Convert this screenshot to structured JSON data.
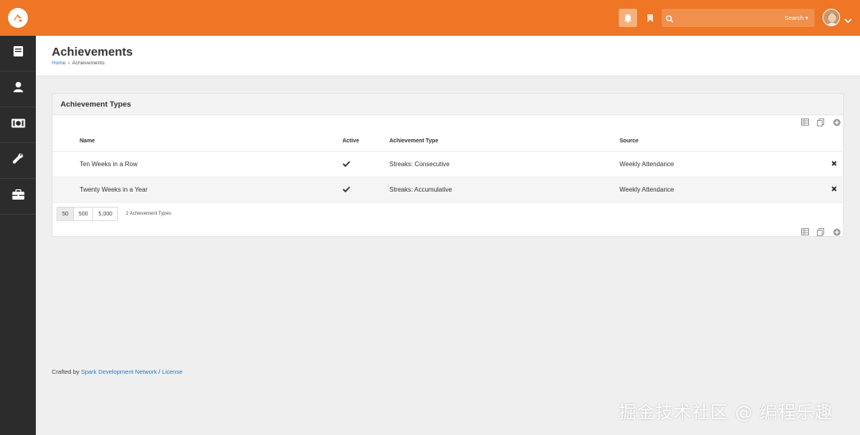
{
  "topbar": {
    "search_placeholder": "",
    "search_button": "Search",
    "colors": {
      "brand": "#ee7624",
      "sidebar": "#2c2c2c",
      "link": "#2a7bc4"
    }
  },
  "sidebar": {
    "items": [
      {
        "icon": "book-icon"
      },
      {
        "icon": "person-icon"
      },
      {
        "icon": "money-icon"
      },
      {
        "icon": "wrench-icon"
      },
      {
        "icon": "briefcase-icon"
      }
    ]
  },
  "page": {
    "title": "Achievements",
    "breadcrumb": {
      "home": "Home",
      "current": "Achievements"
    }
  },
  "panel": {
    "title": "Achievement Types",
    "columns": {
      "name": "Name",
      "active": "Active",
      "type": "Achievement Type",
      "source": "Source"
    },
    "rows": [
      {
        "name": "Ten Weeks in a Row",
        "active": true,
        "type": "Streaks: Consecutive",
        "source": "Weekly Attendance"
      },
      {
        "name": "Twenty Weeks in a Year",
        "active": true,
        "type": "Streaks: Accumulative",
        "source": "Weekly Attendance"
      }
    ],
    "pager": {
      "sizes": [
        "50",
        "500",
        "5,000"
      ],
      "count": "2 Achievement Types"
    }
  },
  "footer": {
    "prefix": "Crafted by",
    "link1": "Spark Development Network",
    "sep": "/",
    "link2": "License"
  },
  "watermark": "掘金技术社区 @ 编程乐趣"
}
